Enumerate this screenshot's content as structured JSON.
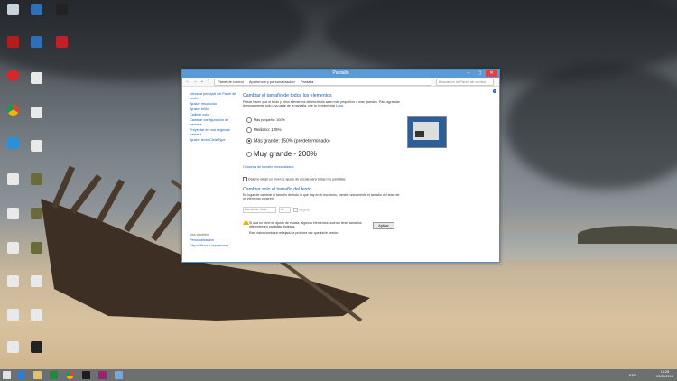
{
  "window": {
    "title": "Pantalla",
    "breadcrumb": [
      "Panel de control",
      "Apariencia y personalización",
      "Pantalla"
    ],
    "search_placeholder": "Buscar en el Panel de control"
  },
  "sidebar": {
    "items": [
      {
        "label": "Ventana principal del Panel de control"
      },
      {
        "label": "Ajustar resolución"
      },
      {
        "label": "Ajustar brillo"
      },
      {
        "label": "Calibrar color"
      },
      {
        "label": "Cambiar configuración de pantalla"
      },
      {
        "label": "Proyectar en una segunda pantalla"
      },
      {
        "label": "Ajustar texto ClearType"
      }
    ],
    "see_also": "Vea también",
    "see_items": [
      {
        "label": "Personalización"
      },
      {
        "label": "Dispositivos e impresoras"
      }
    ]
  },
  "main": {
    "heading": "Cambiar el tamaño de todos los elementos",
    "desc": "Puede hacer que el texto y otros elementos del escritorio sean más pequeños o más grandes. Para agrandar temporalmente solo una parte de la pantalla, use la herramienta",
    "desc_link": "Lupa.",
    "options": [
      {
        "label": "Más pequeño: 100%",
        "selected": false
      },
      {
        "label": "Mediano: 125%",
        "selected": false
      },
      {
        "label": "Más grande: 150% (predeterminado)",
        "selected": true
      },
      {
        "label": "Muy grande - 200%",
        "selected": false
      }
    ],
    "custom_link": "Opciones de tamaño personalizado",
    "checkbox_label": "Déjeme elegir un nivel de ajuste de escala para todas mis pantallas",
    "heading2": "Cambiar solo el tamaño del texto",
    "desc2": "En lugar de cambiar el tamaño de todo lo que hay en el escritorio, cambie únicamente el tamaño del texto de un elemento concreto.",
    "text_select": "Barras de título",
    "size_select": "11",
    "bold_label": "Negrita",
    "warning": "Si usa un nivel de ajuste de escala, algunos elementos podrían tener tamaños diferentes en pantallas distintas.",
    "warning2": "Este valor cambiará reflejado la próxima vez que inicie sesión.",
    "apply": "Aplicar"
  },
  "taskbar": {
    "time": "16:28",
    "date": "03/06/2015",
    "lang": "ESP"
  }
}
